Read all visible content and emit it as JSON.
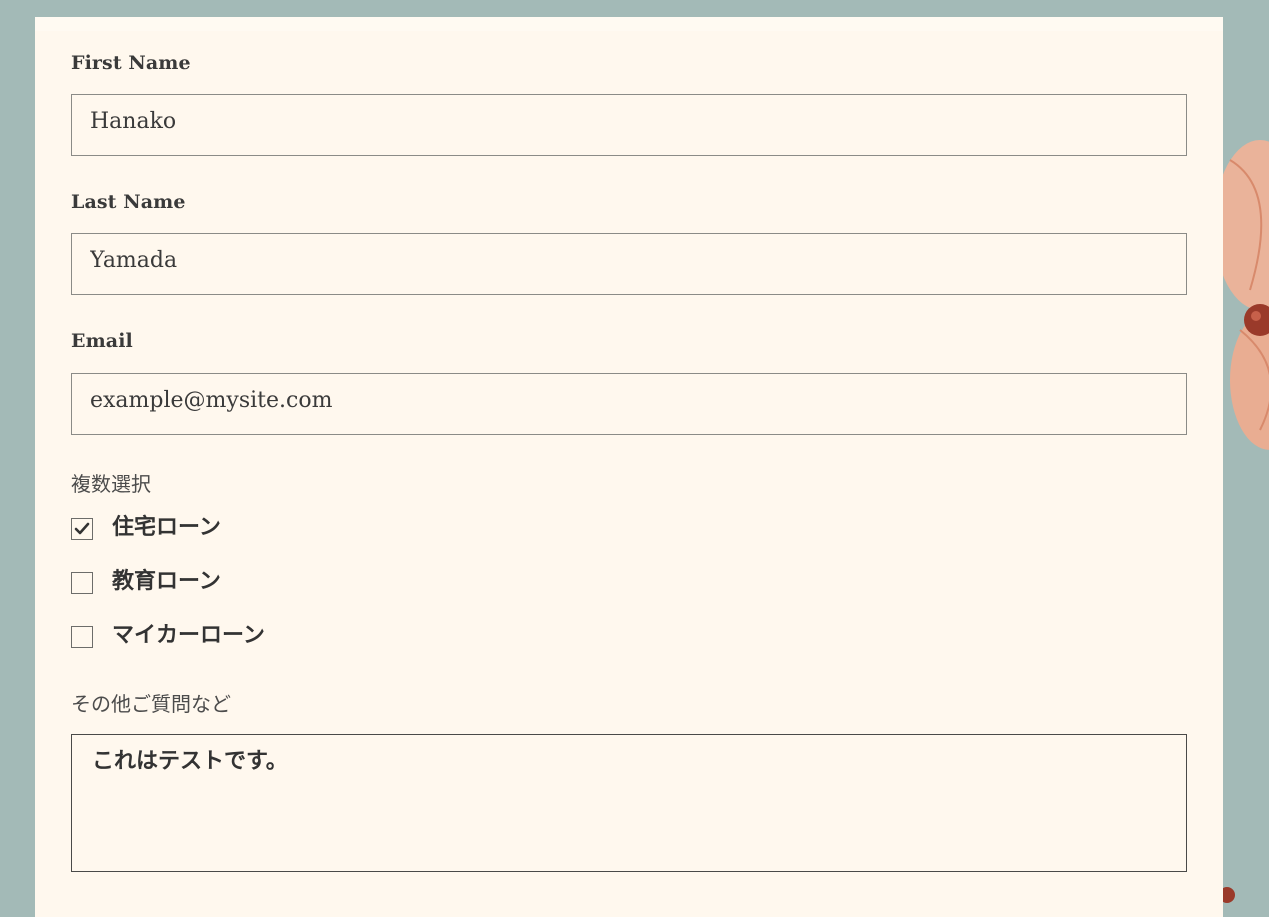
{
  "form": {
    "first_name": {
      "label": "First Name",
      "value": "Hanako"
    },
    "last_name": {
      "label": "Last Name",
      "value": "Yamada"
    },
    "email": {
      "label": "Email",
      "value": "example@mysite.com"
    },
    "multi_select": {
      "label": "複数選択",
      "options": [
        {
          "label": "住宅ローン",
          "checked": true
        },
        {
          "label": "教育ローン",
          "checked": false
        },
        {
          "label": "マイカーローン",
          "checked": false
        }
      ]
    },
    "questions": {
      "label": "その他ご質問など",
      "value": "これはテストです。"
    }
  },
  "icons": {
    "checkmark": "check-icon",
    "decoration": "flower-illustration"
  },
  "colors": {
    "background": "#a3bab7",
    "card": "#fff8ee",
    "text": "#3a3a3a",
    "border": "#8b8b87",
    "flower": "#e7a98a"
  }
}
